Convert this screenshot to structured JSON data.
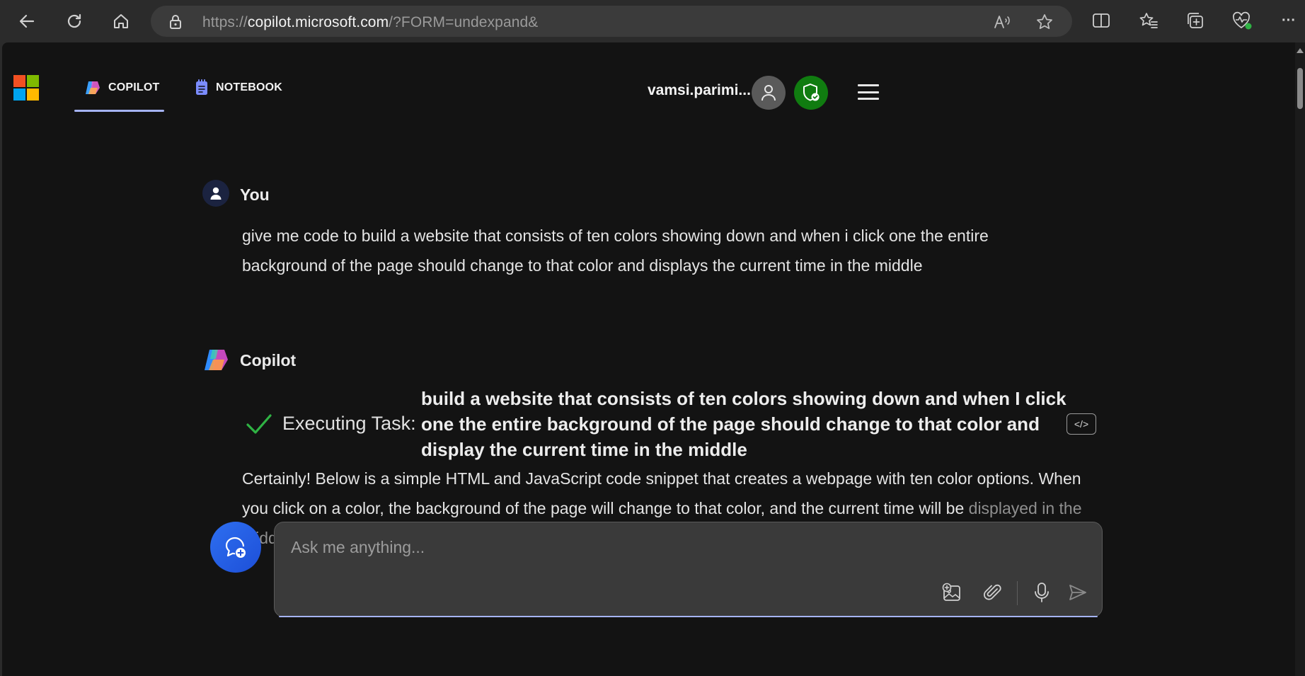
{
  "browser": {
    "url_prefix": "https://",
    "url_host": "copilot.microsoft.com",
    "url_path": "/?FORM=undexpand&",
    "more_label": "···"
  },
  "header": {
    "tabs": [
      {
        "label": "COPILOT",
        "active": true
      },
      {
        "label": "NOTEBOOK",
        "active": false
      }
    ],
    "user_name": "vamsi.parimi..."
  },
  "conversation": {
    "user": {
      "label": "You",
      "message": "give me code to build a website that consists of ten colors showing down and when i click one the entire background of the page should change to that color and displays the current time in the middle"
    },
    "copilot": {
      "label": "Copilot",
      "task_label": "Executing Task:",
      "task_description": "build a website that consists of ten colors showing down and when I click one the entire background of the page should change to that color and display the current time in the middle",
      "code_button_label": "</>",
      "response_main": "Certainly! Below is a simple HTML and JavaScript code snippet that creates a webpage with ten color options. When you click on a color, the background of the page will change to that color, and the current time will be ",
      "response_faded": "displayed in the middle:"
    }
  },
  "composer": {
    "placeholder": "Ask me anything..."
  },
  "colors": {
    "page_bg": "#131313",
    "accent": "#a5b3f5",
    "shield_green": "#107c10",
    "new_topic_blue": "#1d4fd8",
    "check_green": "#2fb344",
    "ms_red": "#f25022",
    "ms_green": "#7fba00",
    "ms_blue": "#00a4ef",
    "ms_yellow": "#ffb900"
  }
}
